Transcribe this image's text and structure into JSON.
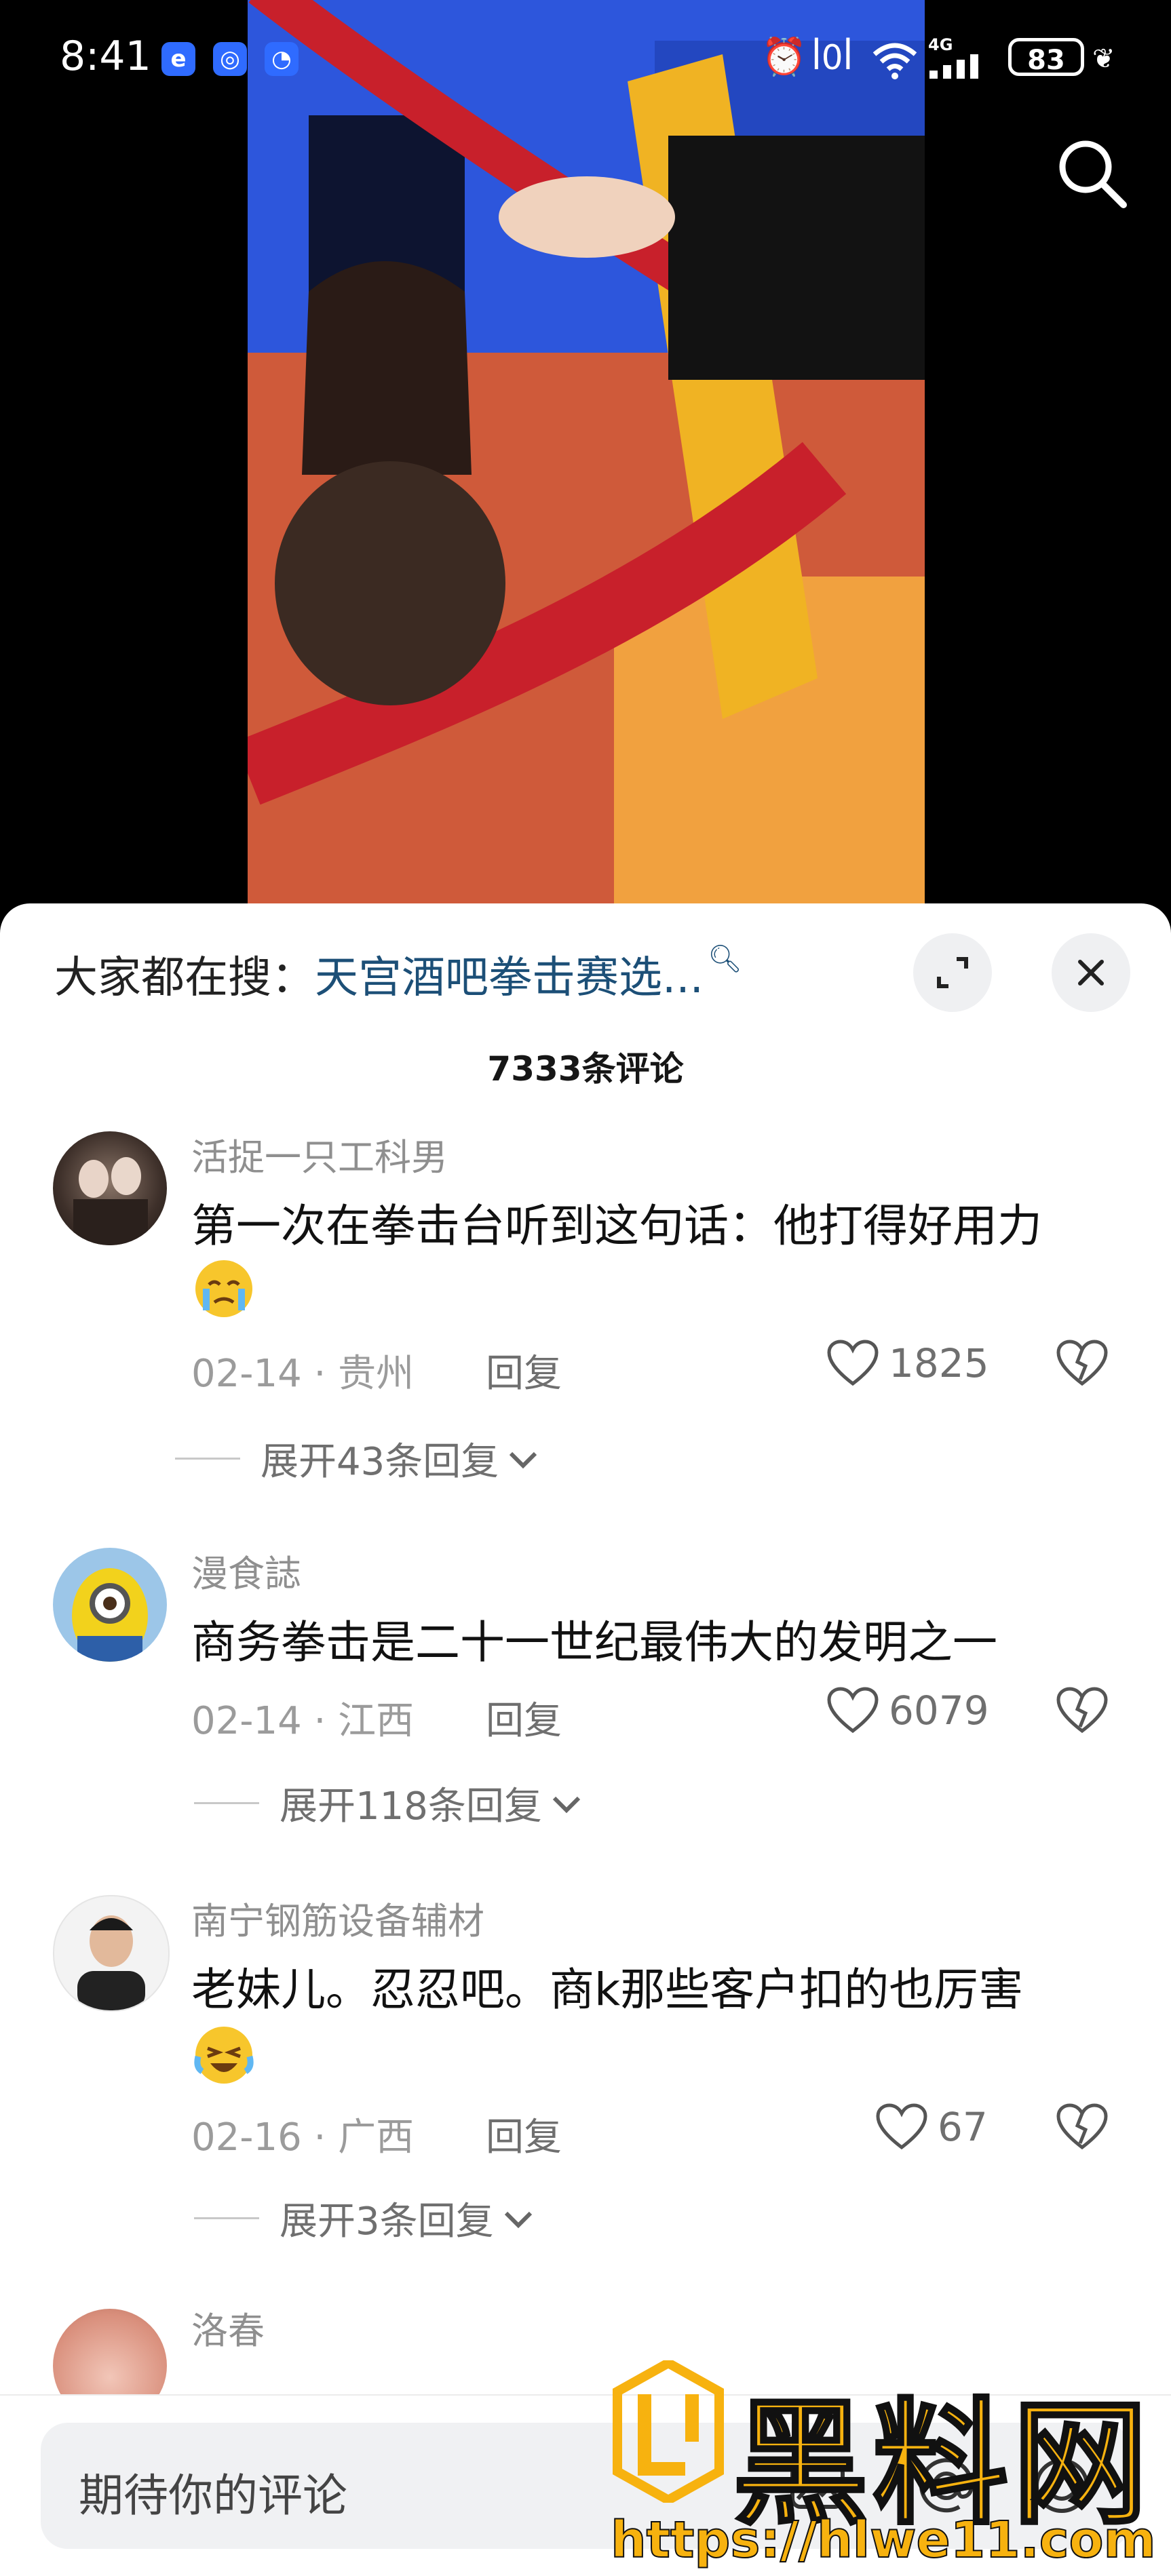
{
  "status_bar": {
    "time": "8:41",
    "network": "4G",
    "battery": "83"
  },
  "panel": {
    "search_prefix": "大家都在搜：",
    "search_keyword": "天宫酒吧拳击赛选...",
    "comment_count": "7333条评论"
  },
  "comments": [
    {
      "user": "活捉一只工科男",
      "text": "第一次在拳击台听到这句话：他打得好用力",
      "date_loc": "02-14 · 贵州",
      "reply": "回复",
      "likes": "1825",
      "expand": "展开43条回复"
    },
    {
      "user": "漫食誌",
      "text": "商务拳击是二十一世纪最伟大的发明之一",
      "date_loc": "02-14 · 江西",
      "reply": "回复",
      "likes": "6079",
      "expand": "展开118条回复"
    },
    {
      "user": "南宁钢筋设备辅材",
      "text": "老妹儿。忍忍吧。商k那些客户扣的也厉害",
      "date_loc": "02-16 · 广西",
      "reply": "回复",
      "likes": "67",
      "expand": "展开3条回复"
    },
    {
      "user": "洛春"
    }
  ],
  "input": {
    "placeholder": "期待你的评论"
  },
  "watermark": {
    "brand": "黑料网",
    "url": "https://hlwe11.com"
  },
  "icons": [
    "search-icon",
    "expand-icon",
    "close-icon",
    "heart-icon",
    "broken-heart-icon",
    "chevron-down-icon",
    "at-icon",
    "emoji-icon",
    "image-icon"
  ],
  "colors": {
    "panel_bg": "#ffffff",
    "keyword": "#1c4f77",
    "watermark": "#f7b20f"
  }
}
